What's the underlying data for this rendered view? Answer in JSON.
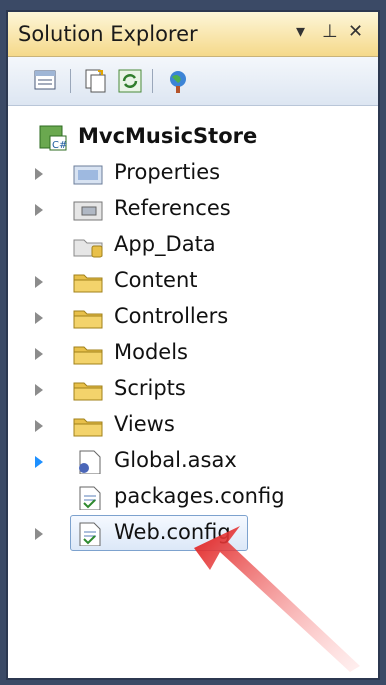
{
  "window": {
    "title": "Solution Explorer"
  },
  "toolbar": {
    "icons": [
      "properties-icon",
      "show-all-files-icon",
      "refresh-icon",
      "view-class-diagram-icon"
    ]
  },
  "tree": {
    "root": {
      "label": "MvcMusicStore",
      "icon": "csharp-project-icon"
    },
    "items": [
      {
        "label": "Properties",
        "icon": "properties-folder-icon",
        "expandable": true
      },
      {
        "label": "References",
        "icon": "references-icon",
        "expandable": true
      },
      {
        "label": "App_Data",
        "icon": "app-data-folder-icon",
        "expandable": false
      },
      {
        "label": "Content",
        "icon": "folder-icon",
        "expandable": true
      },
      {
        "label": "Controllers",
        "icon": "folder-icon",
        "expandable": true
      },
      {
        "label": "Models",
        "icon": "folder-icon",
        "expandable": true
      },
      {
        "label": "Scripts",
        "icon": "folder-icon",
        "expandable": true
      },
      {
        "label": "Views",
        "icon": "folder-icon",
        "expandable": true
      },
      {
        "label": "Global.asax",
        "icon": "global-asax-icon",
        "expandable": true
      },
      {
        "label": "packages.config",
        "icon": "config-file-icon",
        "expandable": false
      },
      {
        "label": "Web.config",
        "icon": "config-file-icon",
        "expandable": true,
        "selected": true
      }
    ]
  },
  "colors": {
    "frame": "#3b4a66",
    "title_bar": "#f5d98a",
    "folder": "#e8c04a",
    "selection_border": "#7da2ce",
    "arrow": "#e02020"
  }
}
